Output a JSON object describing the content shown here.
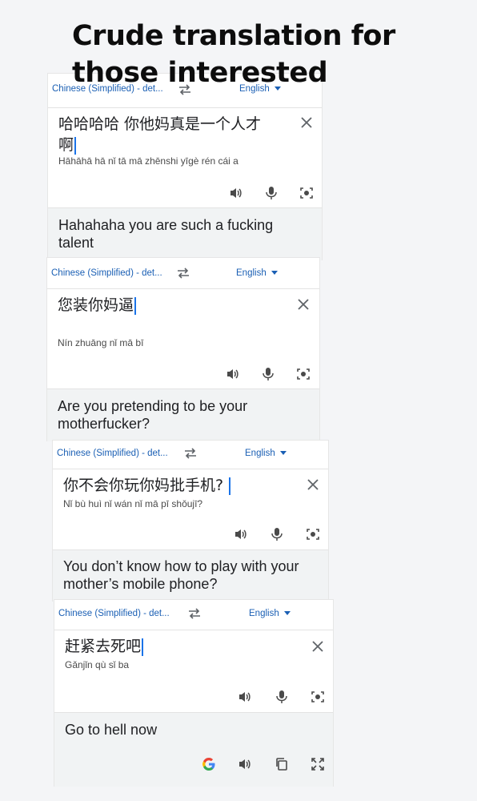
{
  "post": {
    "title": "Crude translation for those interested"
  },
  "cards": [
    {
      "source_lang": "Chinese (Simplified) - det...",
      "target_lang": "English",
      "source_text": "哈哈哈哈  你他妈真是一个人才啊",
      "romanization": "Hāhāhā hā  nǐ tā mā zhēnshi yīgè rén cái a",
      "translation": "Hahahaha you are such a fucking talent"
    },
    {
      "source_lang": "Chinese (Simplified) - det...",
      "target_lang": "English",
      "source_text": "您装你妈逼",
      "romanization": "Nín zhuāng nǐ mā bī",
      "translation": "Are you pretending to be your motherfucker?"
    },
    {
      "source_lang": "Chinese (Simplified) - det...",
      "target_lang": "English",
      "source_text": "你不会你玩你妈批手机?",
      "romanization": "Nǐ bù huì nǐ wán nǐ mā pī shǒujī?",
      "translation": "You don’t know how to play with your mother’s mobile phone?"
    },
    {
      "source_lang": "Chinese (Simplified) - det...",
      "target_lang": "English",
      "source_text": "赶紧去死吧",
      "romanization": "Gǎnjǐn qù sǐ ba",
      "translation": "Go to hell now"
    }
  ],
  "icons": {
    "speaker": "speaker-icon",
    "mic": "microphone-icon",
    "camera": "camera-lens-icon",
    "swap": "swap-arrows-icon",
    "close": "close-icon",
    "google": "google-g-icon",
    "copy": "copy-icon",
    "fullscreen": "fullscreen-icon"
  },
  "colors": {
    "link_blue": "#1a5fb4",
    "cursor_blue": "#1a73e8",
    "output_bg": "#f1f3f4"
  }
}
